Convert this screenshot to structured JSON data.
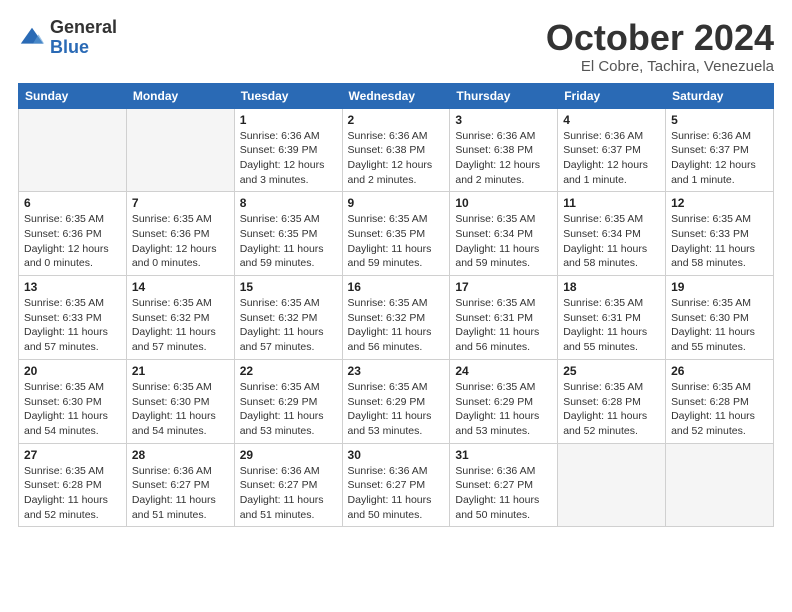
{
  "logo": {
    "general": "General",
    "blue": "Blue"
  },
  "title": "October 2024",
  "location": "El Cobre, Tachira, Venezuela",
  "headers": [
    "Sunday",
    "Monday",
    "Tuesday",
    "Wednesday",
    "Thursday",
    "Friday",
    "Saturday"
  ],
  "weeks": [
    [
      {
        "day": "",
        "info": ""
      },
      {
        "day": "",
        "info": ""
      },
      {
        "day": "1",
        "info": "Sunrise: 6:36 AM\nSunset: 6:39 PM\nDaylight: 12 hours\nand 3 minutes."
      },
      {
        "day": "2",
        "info": "Sunrise: 6:36 AM\nSunset: 6:38 PM\nDaylight: 12 hours\nand 2 minutes."
      },
      {
        "day": "3",
        "info": "Sunrise: 6:36 AM\nSunset: 6:38 PM\nDaylight: 12 hours\nand 2 minutes."
      },
      {
        "day": "4",
        "info": "Sunrise: 6:36 AM\nSunset: 6:37 PM\nDaylight: 12 hours\nand 1 minute."
      },
      {
        "day": "5",
        "info": "Sunrise: 6:36 AM\nSunset: 6:37 PM\nDaylight: 12 hours\nand 1 minute."
      }
    ],
    [
      {
        "day": "6",
        "info": "Sunrise: 6:35 AM\nSunset: 6:36 PM\nDaylight: 12 hours\nand 0 minutes."
      },
      {
        "day": "7",
        "info": "Sunrise: 6:35 AM\nSunset: 6:36 PM\nDaylight: 12 hours\nand 0 minutes."
      },
      {
        "day": "8",
        "info": "Sunrise: 6:35 AM\nSunset: 6:35 PM\nDaylight: 11 hours\nand 59 minutes."
      },
      {
        "day": "9",
        "info": "Sunrise: 6:35 AM\nSunset: 6:35 PM\nDaylight: 11 hours\nand 59 minutes."
      },
      {
        "day": "10",
        "info": "Sunrise: 6:35 AM\nSunset: 6:34 PM\nDaylight: 11 hours\nand 59 minutes."
      },
      {
        "day": "11",
        "info": "Sunrise: 6:35 AM\nSunset: 6:34 PM\nDaylight: 11 hours\nand 58 minutes."
      },
      {
        "day": "12",
        "info": "Sunrise: 6:35 AM\nSunset: 6:33 PM\nDaylight: 11 hours\nand 58 minutes."
      }
    ],
    [
      {
        "day": "13",
        "info": "Sunrise: 6:35 AM\nSunset: 6:33 PM\nDaylight: 11 hours\nand 57 minutes."
      },
      {
        "day": "14",
        "info": "Sunrise: 6:35 AM\nSunset: 6:32 PM\nDaylight: 11 hours\nand 57 minutes."
      },
      {
        "day": "15",
        "info": "Sunrise: 6:35 AM\nSunset: 6:32 PM\nDaylight: 11 hours\nand 57 minutes."
      },
      {
        "day": "16",
        "info": "Sunrise: 6:35 AM\nSunset: 6:32 PM\nDaylight: 11 hours\nand 56 minutes."
      },
      {
        "day": "17",
        "info": "Sunrise: 6:35 AM\nSunset: 6:31 PM\nDaylight: 11 hours\nand 56 minutes."
      },
      {
        "day": "18",
        "info": "Sunrise: 6:35 AM\nSunset: 6:31 PM\nDaylight: 11 hours\nand 55 minutes."
      },
      {
        "day": "19",
        "info": "Sunrise: 6:35 AM\nSunset: 6:30 PM\nDaylight: 11 hours\nand 55 minutes."
      }
    ],
    [
      {
        "day": "20",
        "info": "Sunrise: 6:35 AM\nSunset: 6:30 PM\nDaylight: 11 hours\nand 54 minutes."
      },
      {
        "day": "21",
        "info": "Sunrise: 6:35 AM\nSunset: 6:30 PM\nDaylight: 11 hours\nand 54 minutes."
      },
      {
        "day": "22",
        "info": "Sunrise: 6:35 AM\nSunset: 6:29 PM\nDaylight: 11 hours\nand 53 minutes."
      },
      {
        "day": "23",
        "info": "Sunrise: 6:35 AM\nSunset: 6:29 PM\nDaylight: 11 hours\nand 53 minutes."
      },
      {
        "day": "24",
        "info": "Sunrise: 6:35 AM\nSunset: 6:29 PM\nDaylight: 11 hours\nand 53 minutes."
      },
      {
        "day": "25",
        "info": "Sunrise: 6:35 AM\nSunset: 6:28 PM\nDaylight: 11 hours\nand 52 minutes."
      },
      {
        "day": "26",
        "info": "Sunrise: 6:35 AM\nSunset: 6:28 PM\nDaylight: 11 hours\nand 52 minutes."
      }
    ],
    [
      {
        "day": "27",
        "info": "Sunrise: 6:35 AM\nSunset: 6:28 PM\nDaylight: 11 hours\nand 52 minutes."
      },
      {
        "day": "28",
        "info": "Sunrise: 6:36 AM\nSunset: 6:27 PM\nDaylight: 11 hours\nand 51 minutes."
      },
      {
        "day": "29",
        "info": "Sunrise: 6:36 AM\nSunset: 6:27 PM\nDaylight: 11 hours\nand 51 minutes."
      },
      {
        "day": "30",
        "info": "Sunrise: 6:36 AM\nSunset: 6:27 PM\nDaylight: 11 hours\nand 50 minutes."
      },
      {
        "day": "31",
        "info": "Sunrise: 6:36 AM\nSunset: 6:27 PM\nDaylight: 11 hours\nand 50 minutes."
      },
      {
        "day": "",
        "info": ""
      },
      {
        "day": "",
        "info": ""
      }
    ]
  ]
}
